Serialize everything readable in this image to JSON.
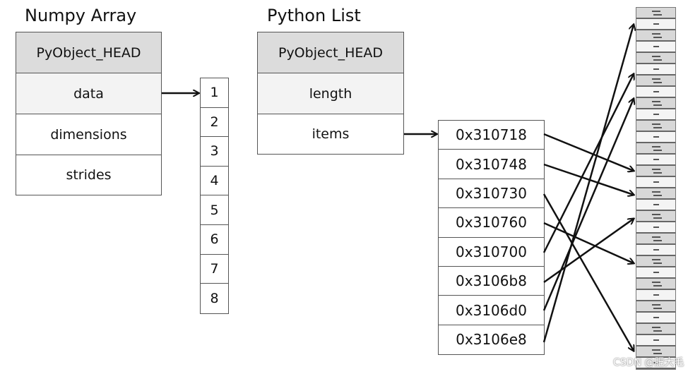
{
  "numpy": {
    "title": "Numpy Array",
    "fields": [
      "PyObject_HEAD",
      "data",
      "dimensions",
      "strides"
    ],
    "values": [
      "1",
      "2",
      "3",
      "4",
      "5",
      "6",
      "7",
      "8"
    ]
  },
  "pylist": {
    "title": "Python List",
    "fields": [
      "PyObject_HEAD",
      "length",
      "items"
    ],
    "addresses": [
      "0x310718",
      "0x310748",
      "0x310730",
      "0x310760",
      "0x310700",
      "0x3106b8",
      "0x3106d0",
      "0x3106e8"
    ]
  },
  "objects": {
    "pairs": 16,
    "colors": {
      "head": "#d8d8d8",
      "value": "#f4f4f4"
    }
  },
  "watermark": "CSDN @肥大毛"
}
